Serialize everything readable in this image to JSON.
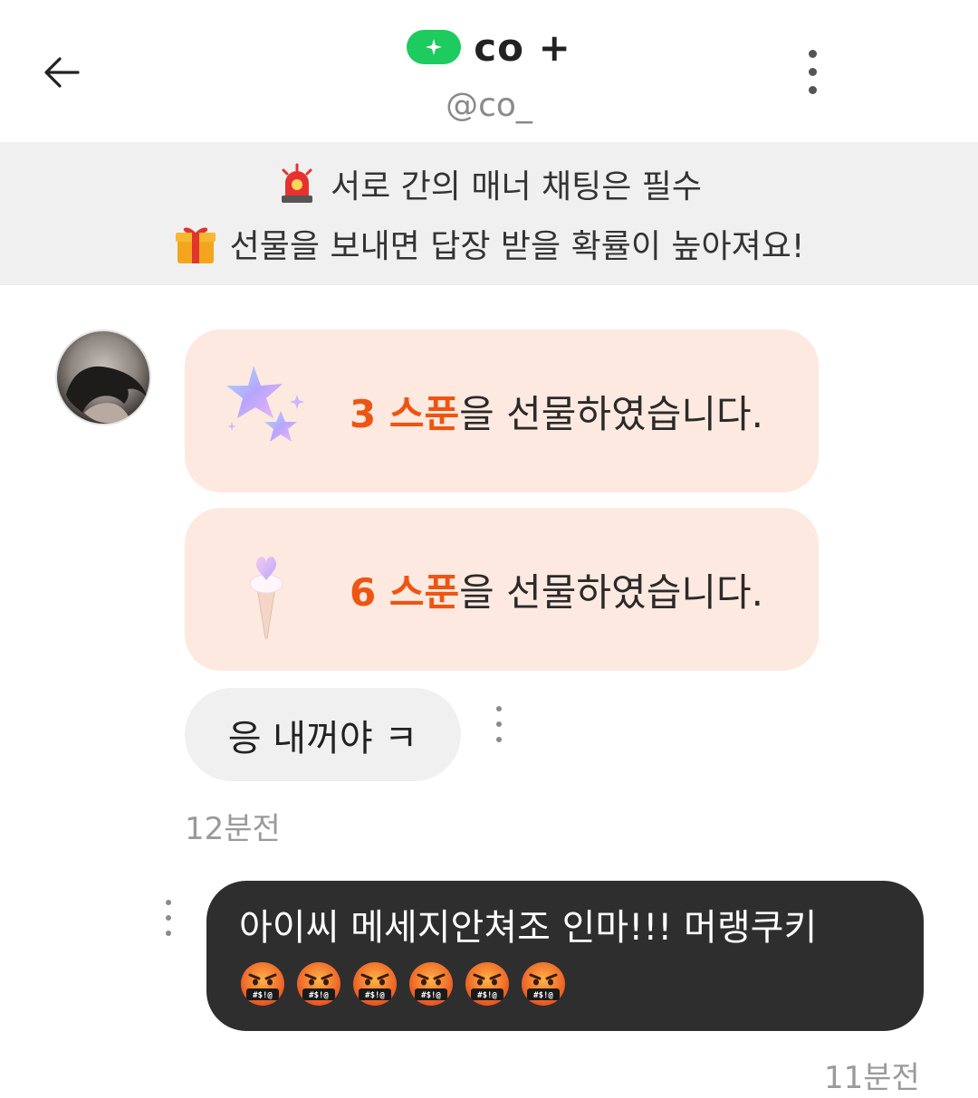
{
  "header": {
    "title": "co +",
    "handle": "@co_",
    "back_icon": "arrow-left-icon",
    "more_icon": "more-vertical-icon",
    "badge_color": "#1ecb5f"
  },
  "notice": {
    "line1": "서로 간의 매너 채팅은 필수",
    "line1_icon": "siren-icon",
    "line2": "선물을 보내면 답장 받을 확률이 높아져요!",
    "line2_icon": "gift-icon"
  },
  "messages": {
    "gift1": {
      "count": "3 스푼",
      "suffix": "을 선물하였습니다.",
      "icon": "sparkle-stars-icon"
    },
    "gift2": {
      "count": "6 스푼",
      "suffix": "을 선물하였습니다.",
      "icon": "ice-cream-cone-icon"
    },
    "incoming": {
      "text": "응 내꺼야 ㅋ",
      "time": "12분전"
    },
    "outgoing": {
      "text": "아이씨 메세지안쳐조 인마!!! 머랭쿠키",
      "emoji_count": 6,
      "emoji_icon": "cursing-face-icon",
      "time": "11분전"
    }
  },
  "colors": {
    "accent": "#ee5412",
    "gift_bubble": "#fde9df",
    "outgoing_bubble": "#2e2e2e",
    "notice_bg": "#f0f0f0"
  }
}
